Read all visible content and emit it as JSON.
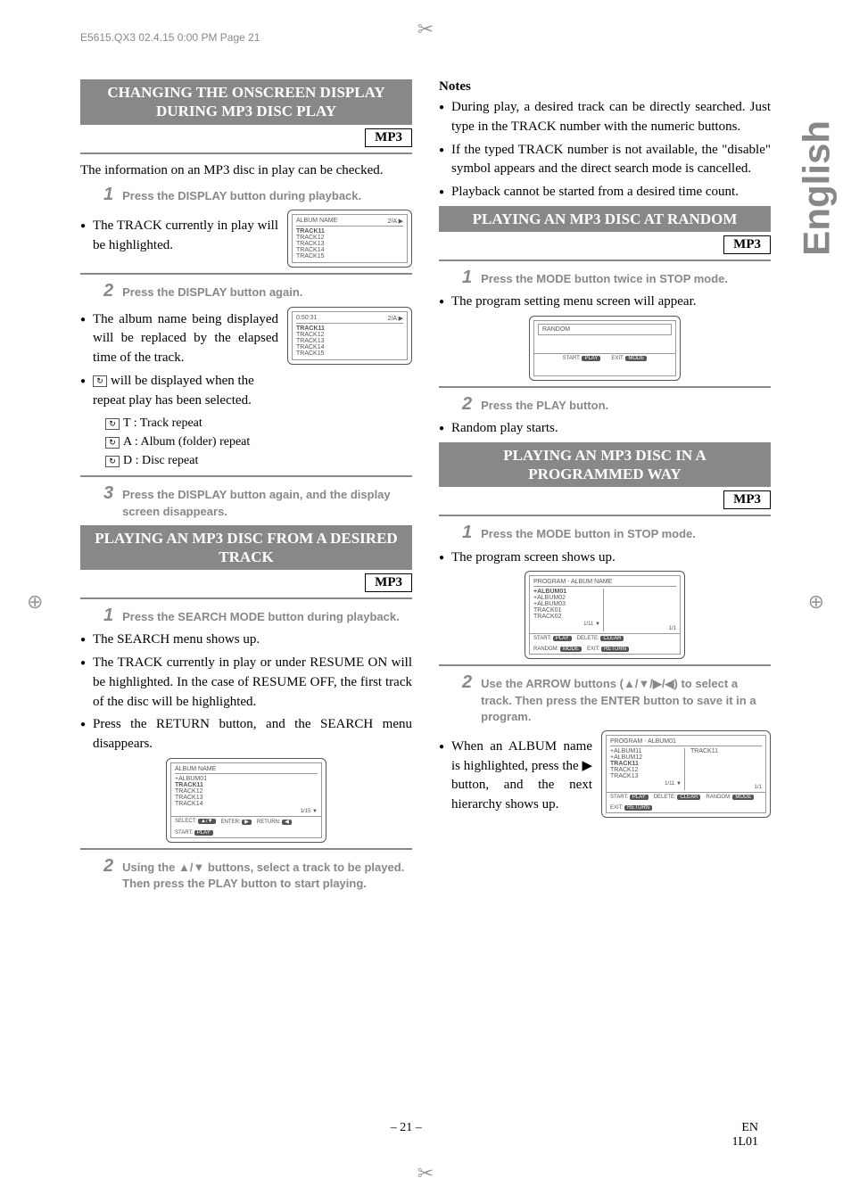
{
  "meta": {
    "header_line": "E5615.QX3  02.4.15 0:00 PM  Page 21",
    "language_tab": "English",
    "page_number": "– 21 –",
    "footer_right1": "EN",
    "footer_right2": "1L01"
  },
  "left": {
    "section1_title": "CHANGING THE ONSCREEN DISPLAY DURING MP3 DISC PLAY",
    "mp3_label": "MP3",
    "intro1": "The information on an MP3 disc in play can be checked.",
    "step1": "Press the DISPLAY button during playback.",
    "bullet1": "The TRACK currently in play will be highlighted.",
    "screen1": {
      "title": "ALBUM NAME",
      "right": "2/A ▶",
      "lines": [
        "TRACK11",
        "TRACK12",
        "TRACK13",
        "TRACK14",
        "TRACK15"
      ]
    },
    "step2": "Press the DISPLAY button again.",
    "bullet2": "The album name being displayed will be replaced by the elapsed time of the track.",
    "bullet3_a": "will be displayed when the",
    "bullet3_b": "repeat play has been selected.",
    "repeat_t": "T : Track repeat",
    "repeat_a": "A : Album (folder) repeat",
    "repeat_d": "D : Disc repeat",
    "screen2": {
      "title": "0:50:31",
      "right": "2/A ▶",
      "lines": [
        "TRACK11",
        "TRACK12",
        "TRACK13",
        "TRACK14",
        "TRACK15"
      ]
    },
    "step3": "Press the DISPLAY button again, and the display screen disappears.",
    "section2_title": "PLAYING AN MP3 DISC FROM A DESIRED TRACK",
    "sec2_step1": "Press the SEARCH MODE button during playback.",
    "sec2_b1": "The SEARCH menu shows up.",
    "sec2_b2": "The TRACK currently in play or under RESUME ON will be highlighted. In the case of RESUME OFF, the first track of the disc will be highlighted.",
    "sec2_b3": "Press the RETURN button, and the SEARCH menu disappears.",
    "screen3": {
      "title": "ALBUM NAME",
      "lines": [
        "+ALBUM01",
        "TRACK11",
        "TRACK12",
        "TRACK13",
        "TRACK14"
      ],
      "counter": "1/15 ▼",
      "bar": [
        "SELECT:",
        "ENTER:",
        "RETURN:",
        "START:"
      ],
      "pills": [
        "▲/▼",
        "▶",
        "◀",
        "PLAY"
      ]
    },
    "sec2_step2": "Using the ▲/▼ buttons, select a track to be played. Then press the PLAY button to start playing."
  },
  "right": {
    "notes_head": "Notes",
    "note1": "During play, a desired track can be directly searched. Just type in the TRACK number with the numeric buttons.",
    "note2": "If the typed TRACK number is not available, the \"disable\" symbol appears and the direct search mode is cancelled.",
    "note3": "Playback cannot be started from a desired time count.",
    "section3_title": "PLAYING AN MP3 DISC AT RANDOM",
    "mp3_label": "MP3",
    "s3_step1": "Press the MODE button twice in STOP mode.",
    "s3_b1": "The program setting menu screen will appear.",
    "screen4": {
      "title": "RANDOM",
      "bar_labels": [
        "START:",
        "EXIT:"
      ],
      "bar_pills": [
        "PLAY",
        "MODE"
      ]
    },
    "s3_step2": "Press the PLAY button.",
    "s3_b2": "Random play starts.",
    "section4_title": "PLAYING AN MP3 DISC IN A PROGRAMMED WAY",
    "s4_step1": "Press the MODE button in STOP mode.",
    "s4_b1": "The program screen shows up.",
    "screen5": {
      "title": "PROGRAM - ALBUM NAME",
      "lines": [
        "+ALBUM01",
        "+ALBUM02",
        "+ALBUM03",
        "TRACK01",
        "TRACK02"
      ],
      "counter_l": "1/11 ▼",
      "counter_r": "1/1",
      "bar_labels": [
        "START:",
        "DELETE:",
        "RANDOM:",
        "EXIT:"
      ],
      "bar_pills": [
        "PLAY",
        "CLEAR",
        "MODE",
        "RETURN"
      ]
    },
    "s4_step2": "Use the ARROW buttons (▲/▼/▶/◀) to select a track. Then press the ENTER button to save it in a program.",
    "s4_b2": "When an ALBUM name is highlighted, press the ▶ button, and the next hierarchy shows up.",
    "screen6": {
      "title": "PROGRAM - ALBUM01",
      "left_lines": [
        "+ALBUM11",
        "+ALBUM12",
        "TRACK11",
        "TRACK12",
        "TRACK13"
      ],
      "right_lines": [
        "TRACK11"
      ],
      "counter_l": "1/11 ▼",
      "counter_r": "1/1",
      "bar_labels": [
        "START:",
        "DELETE:",
        "RANDOM:",
        "EXIT:"
      ],
      "bar_pills": [
        "PLAY",
        "CLEAR",
        "MODE",
        "RETURN"
      ]
    }
  }
}
